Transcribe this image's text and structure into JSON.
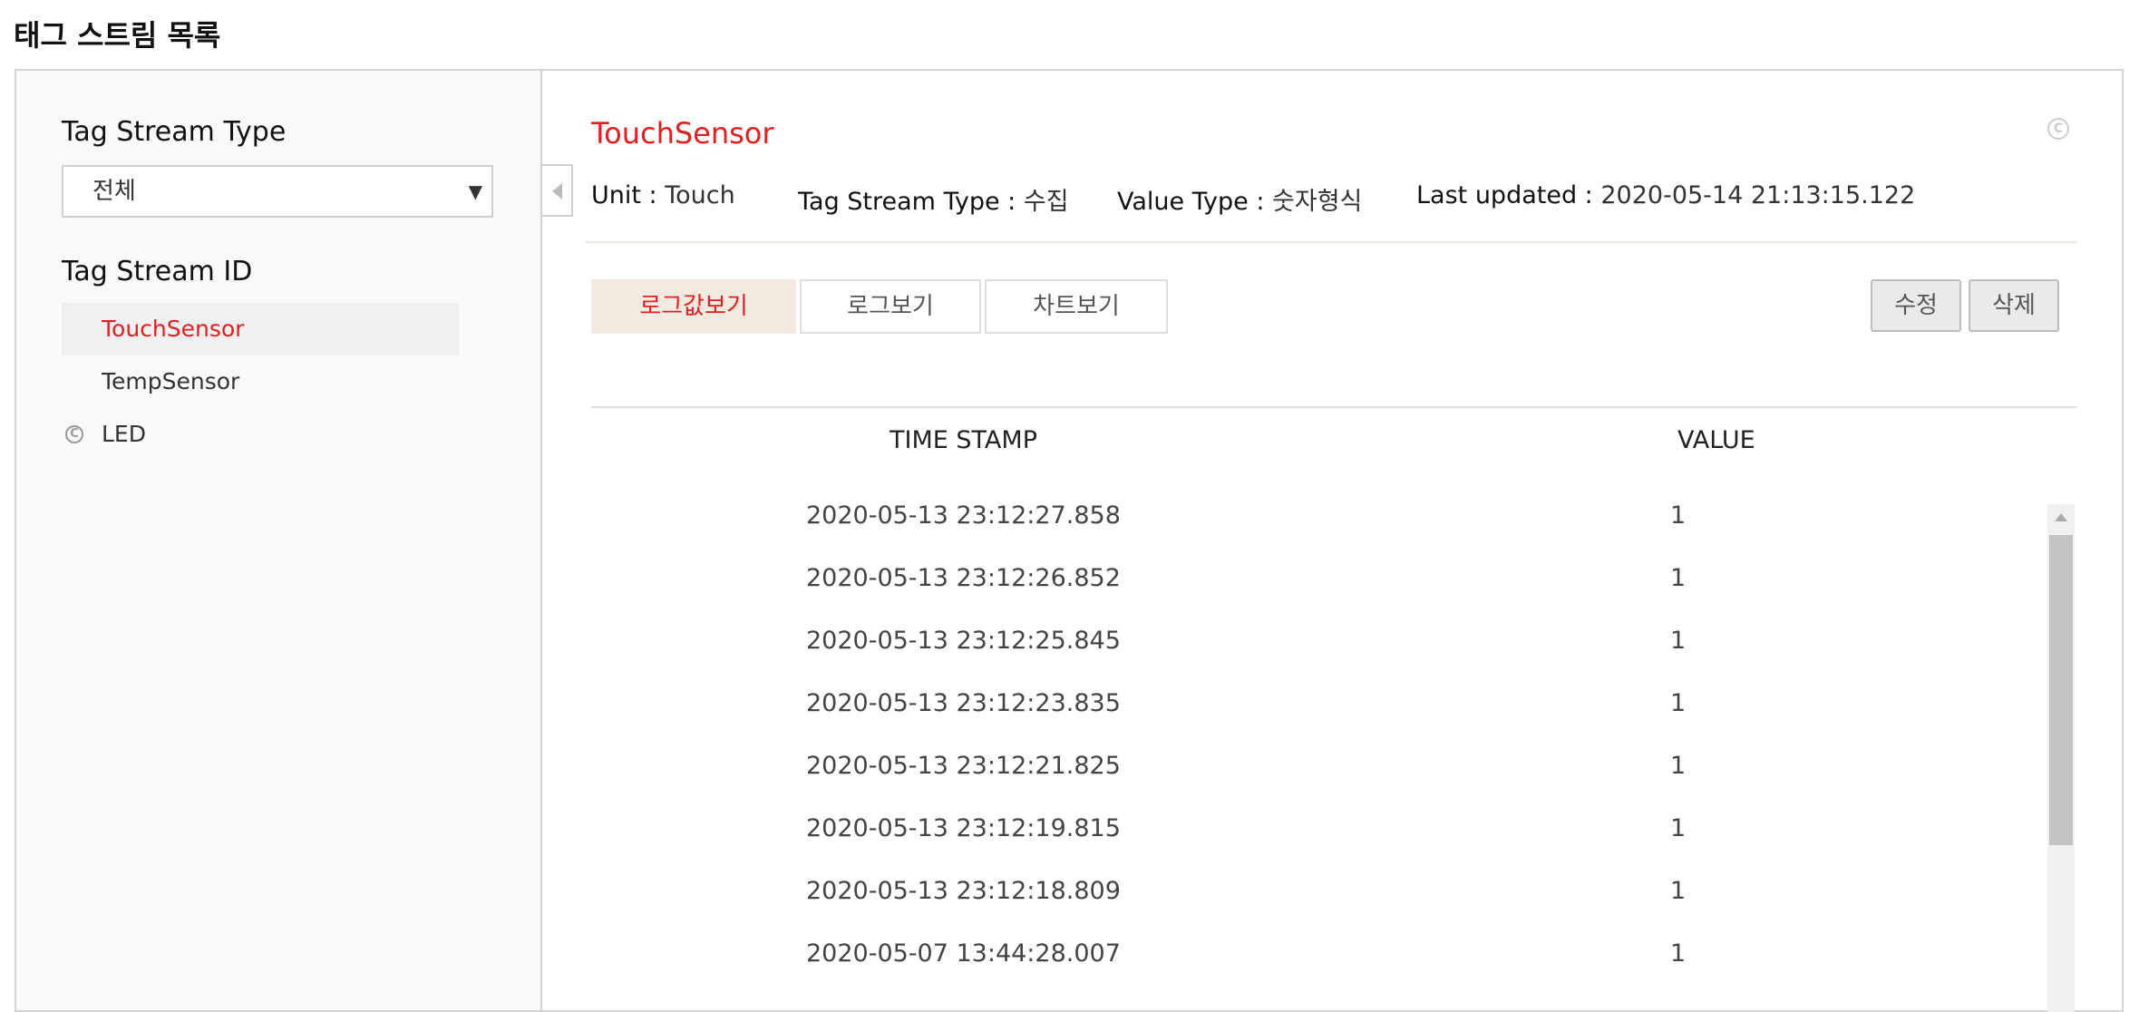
{
  "page": {
    "title": "태그 스트림 목록"
  },
  "sidebar": {
    "type_heading": "Tag Stream Type",
    "type_select": {
      "value": "전체",
      "arrow": "▼"
    },
    "id_heading": "Tag Stream ID",
    "items": [
      {
        "label": "TouchSensor",
        "active": true
      },
      {
        "label": "TempSensor",
        "active": false
      },
      {
        "label": "LED",
        "active": false,
        "icon": "copyright-icon"
      }
    ]
  },
  "detail": {
    "title": "TouchSensor",
    "unit_label": "Unit :",
    "unit_value": "Touch",
    "type_label": "Tag Stream Type :",
    "type_value": "수집",
    "value_type_label": "Value Type :",
    "value_type_value": "숫자형식",
    "updated_label": "Last updated :",
    "updated_value": "2020-05-14 21:13:15.122"
  },
  "tabs": [
    {
      "label": "로그값보기",
      "active": true
    },
    {
      "label": "로그보기",
      "active": false
    },
    {
      "label": "차트보기",
      "active": false
    }
  ],
  "actions": {
    "edit_label": "수정",
    "delete_label": "삭제"
  },
  "table": {
    "headers": {
      "timestamp": "TIME STAMP",
      "value": "VALUE"
    },
    "rows": [
      {
        "timestamp": "2020-05-13 23:12:27.858",
        "value": "1"
      },
      {
        "timestamp": "2020-05-13 23:12:26.852",
        "value": "1"
      },
      {
        "timestamp": "2020-05-13 23:12:25.845",
        "value": "1"
      },
      {
        "timestamp": "2020-05-13 23:12:23.835",
        "value": "1"
      },
      {
        "timestamp": "2020-05-13 23:12:21.825",
        "value": "1"
      },
      {
        "timestamp": "2020-05-13 23:12:19.815",
        "value": "1"
      },
      {
        "timestamp": "2020-05-13 23:12:18.809",
        "value": "1"
      },
      {
        "timestamp": "2020-05-07 13:44:28.007",
        "value": "1"
      }
    ]
  },
  "colors": {
    "accent": "#e02020",
    "active_tab_bg": "#f3ebe1"
  }
}
